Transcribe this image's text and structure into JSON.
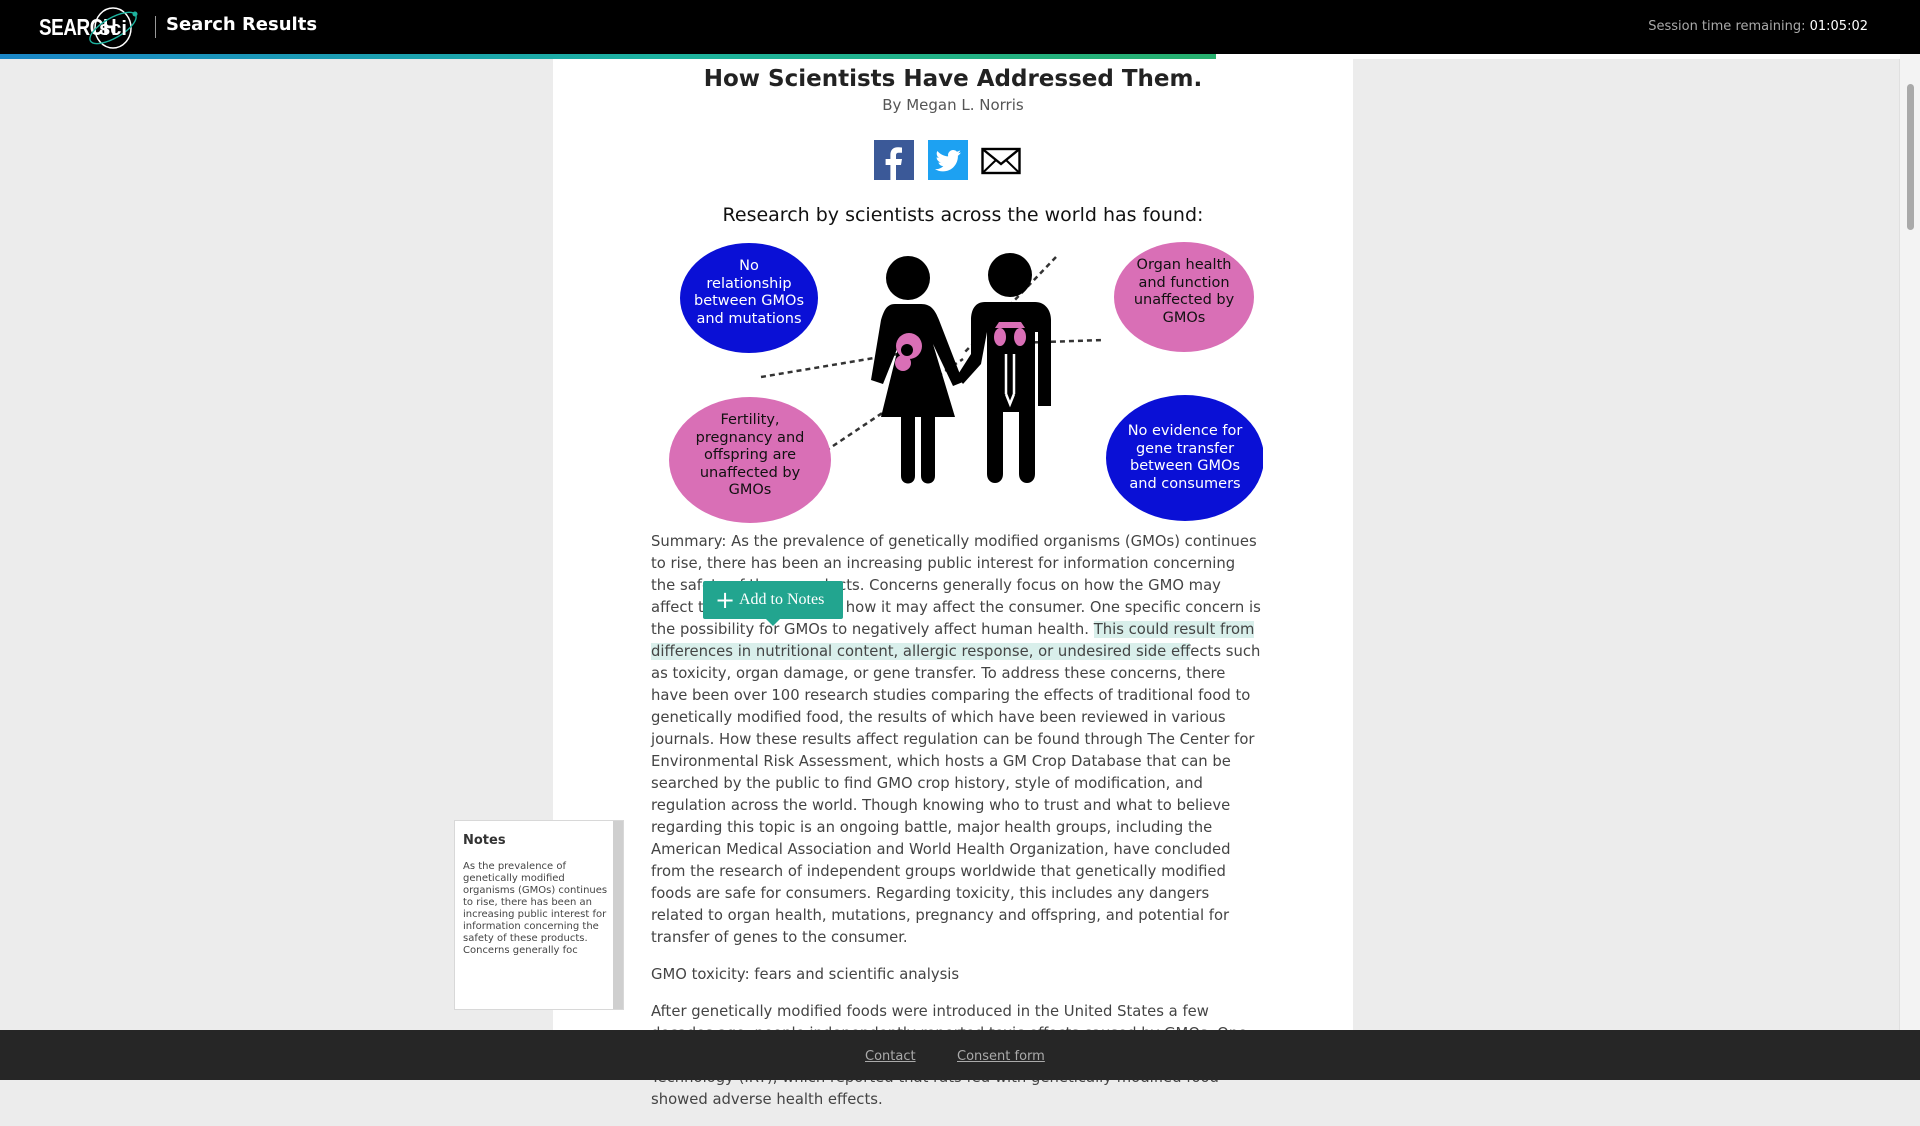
{
  "header": {
    "logo_text": "SEARCH",
    "logo_mark": "sci",
    "title": "Search Results",
    "session_label": "Session time remaining:",
    "session_time": "01:05:02",
    "progress_fraction": 0.64
  },
  "article": {
    "title": "How Scientists Have Addressed Them.",
    "byline": "By Megan L. Norris",
    "share": [
      {
        "icon": "facebook-icon",
        "color": "#3b5998"
      },
      {
        "icon": "twitter-icon",
        "color": "#1da1f2"
      },
      {
        "icon": "email-icon",
        "color": "#000000"
      }
    ],
    "infographic": {
      "heading": "Research by scientists across the world has found:",
      "bubbles": [
        {
          "text": [
            "No",
            "relationship",
            "between GMOs",
            "and mutations"
          ],
          "color": "#0a10d6"
        },
        {
          "text": [
            "Organ health",
            "and function",
            "unaffected by",
            "GMOs"
          ],
          "color": "#d96fb6"
        },
        {
          "text": [
            "Fertility,",
            "pregnancy and",
            "offspring are",
            "unaffected by",
            "GMOs"
          ],
          "color": "#d96fb6"
        },
        {
          "text": [
            "No evidence for",
            "gene transfer",
            "between GMOs",
            "and consumers"
          ],
          "color": "#0a10d6"
        }
      ]
    },
    "summary_before": "Summary: As the prevalence of genetically modified organisms (GMOs) continues to rise, there has been an increasing public interest for information concerning the safety of these products. Concerns generally focus on how the GMO may affect the environment or how it may affect the consumer. One specific concern is the possibility for GMOs to negatively affect human health. ",
    "summary_highlight": "This could result from differences in nutritional content, allergic response, or undesired side eff",
    "summary_after": "ects such as toxicity, organ damage, or gene transfer. To address these concerns, there have been over 100 research studies comparing the effects of traditional food to genetically modified food, the results of which have been reviewed in various journals. How these results affect regulation can be found through The Center for Environmental Risk Assessment, which hosts a GM Crop Database that can be searched by the public to find GMO crop history, style of modification, and regulation across the world. Though knowing who to trust and what to believe regarding this topic is an ongoing battle, major health groups, including the American Medical Association and World Health Organization, have concluded from the research of independent groups worldwide that genetically modified foods are safe for consumers. Regarding toxicity, this includes any dangers related to organ health, mutations, pregnancy and offspring, and potential for transfer of genes to the consumer.",
    "section_heading": "GMO toxicity: fears and scientific analysis",
    "section_paragraph": "After genetically modified foods were introduced in the United States a few decades ago, people independently reported toxic effects caused by GMOs. One example is an anti-GMO advocacy group called the Institute for Responsible Technology (IRT), which reported that rats fed with genetically modified food showed adverse health effects."
  },
  "tooltip": {
    "add_notes_label": "Add to Notes"
  },
  "notes": {
    "title": "Notes",
    "content": "As the prevalence of genetically modified organisms (GMOs) continues to rise, there has been an increasing public interest for information concerning the safety of these products. Concerns generally foc"
  },
  "footer": {
    "contact": "Contact",
    "consent": "Consent form"
  }
}
